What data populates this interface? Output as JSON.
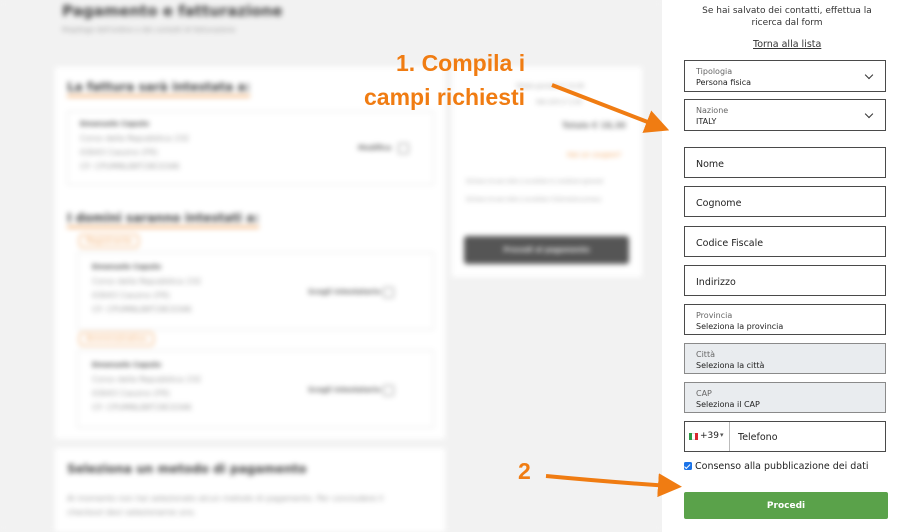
{
  "background": {
    "page_title": "Pagamento e fatturazione",
    "page_subtitle": "Riepilogo dell'ordine e dei contatti di fatturazione",
    "invoice_heading": "La fattura sarà intestata a:",
    "invoice_contact": {
      "name": "Emanuele Caputo",
      "address": "Corso della Repubblica 232",
      "city": "03043 Cassino (FR)",
      "cf": "CF: CPUMNL88T28C034K",
      "edit": "Modifica"
    },
    "domains_heading": "I domini saranno intestati a:",
    "domain_contacts": [
      {
        "tag": "Registrante",
        "name": "Emanuele Caputo",
        "address": "Corso della Repubblica 232",
        "city": "03043 Cassino (FR)",
        "cf": "CF: CPUMNL88T28C034K",
        "edit": "Scegli intestatario"
      },
      {
        "tag": "Amministrativo",
        "name": "Emanuele Caputo",
        "address": "Corso della Repubblica 232",
        "city": "03043 Cassino (FR)",
        "cf": "CF: CPUMNL88T28C034K",
        "edit": "Scegli intestatario"
      }
    ],
    "summary": {
      "line1": "Totale parziale € 15,00",
      "line2": "IVA 22% € 3,30",
      "total": "Totale € 18,30",
      "coupon": "Hai un coupon?",
      "terms1": "Dichiaro di aver letto e accettato le condizioni generali",
      "terms2": "Dichiaro di aver letto e accettato l'informativa privacy",
      "pay_button": "Procedi al pagamento"
    },
    "payment_heading": "Seleziona un metodo di pagamento",
    "payment_text": "Al momento non hai selezionato alcun metodo di pagamento. Per concludere il checkout devi selezionarne uno."
  },
  "form": {
    "saved_note": "Se hai salvato dei contatti, effettua la ricerca dal form",
    "back_link": "Torna alla lista",
    "tipologia": {
      "label": "Tipologia",
      "value": "Persona fisica"
    },
    "nazione": {
      "label": "Nazione",
      "value": "ITALY"
    },
    "nome": "Nome",
    "cognome": "Cognome",
    "codice_fiscale": "Codice Fiscale",
    "indirizzo": "Indirizzo",
    "provincia": {
      "label": "Provincia",
      "value": "Seleziona la provincia"
    },
    "citta": {
      "label": "Città",
      "value": "Seleziona la città"
    },
    "cap": {
      "label": "CAP",
      "value": "Seleziona il CAP"
    },
    "phone_prefix": "+39",
    "telefono": "Telefono",
    "consent": "Consenso alla pubblicazione dei dati",
    "submit": "Procedi"
  },
  "annotations": {
    "step1": "1. Compila i",
    "step1b": "campi richiesti",
    "step2": "2",
    "color": "#f07c12"
  }
}
